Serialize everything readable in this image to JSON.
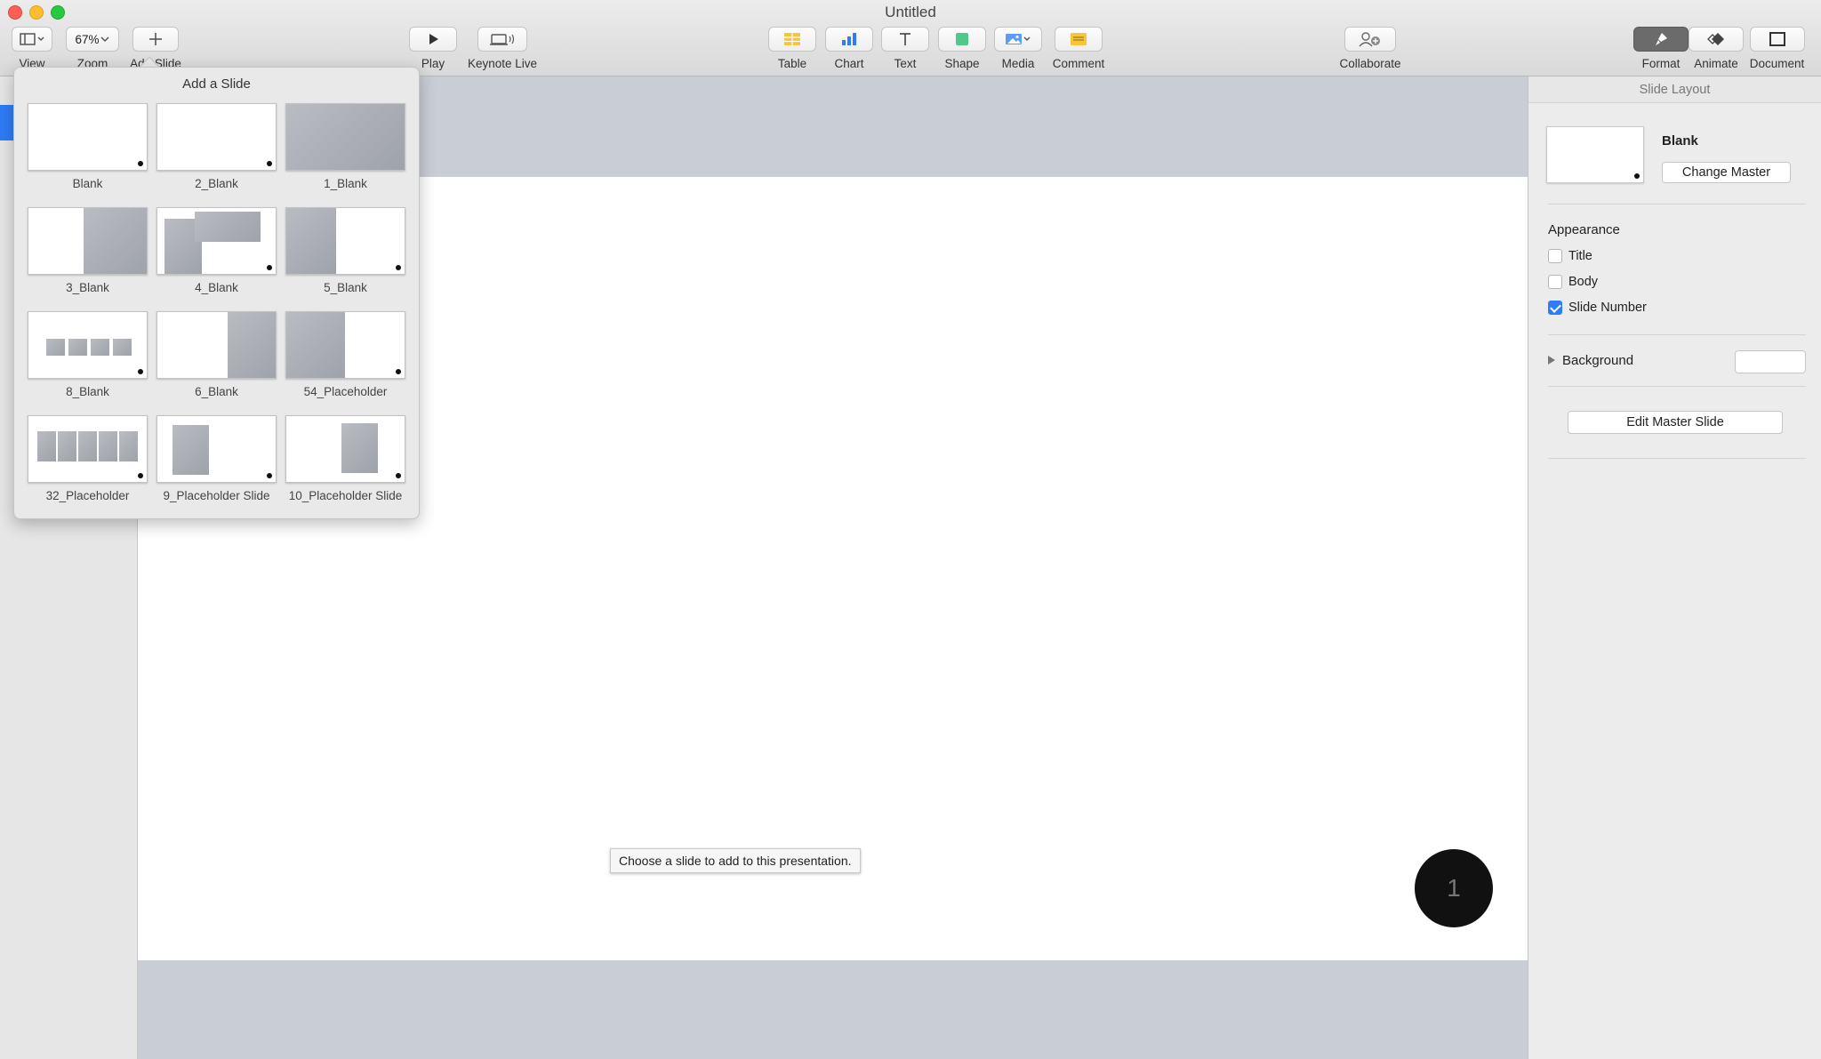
{
  "window": {
    "title": "Untitled"
  },
  "toolbar": {
    "view_label": "View",
    "zoom_value": "67%",
    "zoom_label": "Zoom",
    "add_slide_label": "Add Slide",
    "play_label": "Play",
    "keynote_live_label": "Keynote Live",
    "table_label": "Table",
    "chart_label": "Chart",
    "text_label": "Text",
    "shape_label": "Shape",
    "media_label": "Media",
    "comment_label": "Comment",
    "collaborate_label": "Collaborate",
    "format_label": "Format",
    "animate_label": "Animate",
    "document_label": "Document",
    "colors": {
      "table": "#f6c53c",
      "chart": "#2f7cf6",
      "shape": "#4fc98a",
      "comment": "#f6c53c"
    }
  },
  "popover": {
    "title": "Add a Slide",
    "layouts": [
      {
        "label": "Blank"
      },
      {
        "label": "2_Blank"
      },
      {
        "label": "1_Blank"
      },
      {
        "label": "3_Blank"
      },
      {
        "label": "4_Blank"
      },
      {
        "label": "5_Blank"
      },
      {
        "label": "8_Blank"
      },
      {
        "label": "6_Blank"
      },
      {
        "label": "54_Placeholder"
      },
      {
        "label": "32_Placeholder"
      },
      {
        "label": "9_Placeholder Slide"
      },
      {
        "label": "10_Placeholder Slide"
      }
    ]
  },
  "canvas": {
    "tooltip": "Choose a slide to add to this presentation.",
    "slide_number": "1"
  },
  "inspector": {
    "header": "Slide Layout",
    "master_name": "Blank",
    "change_master_label": "Change Master",
    "appearance_title": "Appearance",
    "title_label": "Title",
    "title_checked": false,
    "body_label": "Body",
    "body_checked": false,
    "slide_number_label": "Slide Number",
    "slide_number_checked": true,
    "background_label": "Background",
    "edit_master_label": "Edit Master Slide"
  }
}
